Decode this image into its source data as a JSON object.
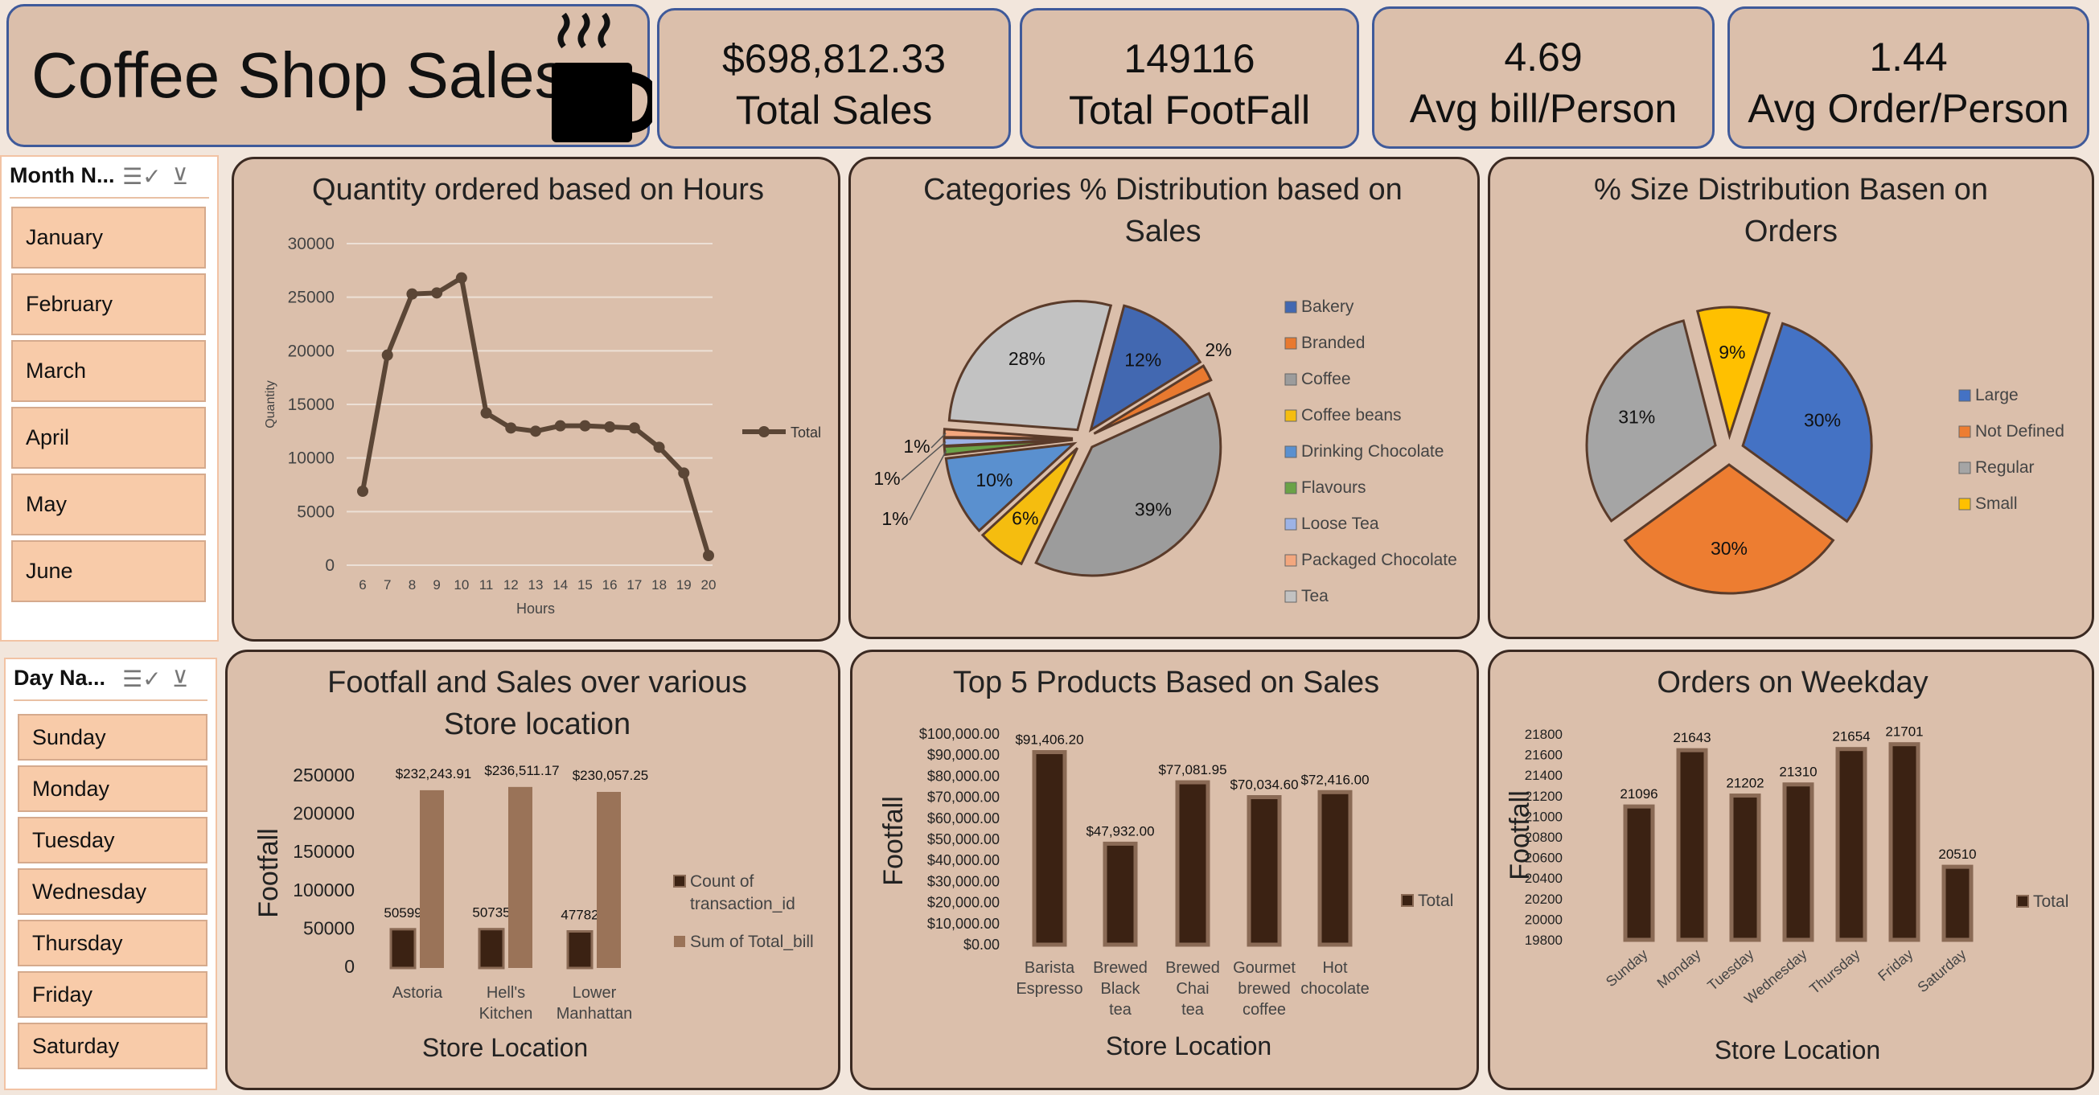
{
  "header": {
    "title": "Coffee Shop Sales"
  },
  "kpis": [
    {
      "value": "$698,812.33",
      "label": "Total Sales"
    },
    {
      "value": "149116",
      "label": "Total FootFall"
    },
    {
      "value": "4.69",
      "label": "Avg bill/Person"
    },
    {
      "value": "1.44",
      "label": "Avg Order/Person"
    }
  ],
  "month_slicer": {
    "header": "Month N...",
    "items": [
      "January",
      "February",
      "March",
      "April",
      "May",
      "June"
    ]
  },
  "day_slicer": {
    "header": "Day Na...",
    "items": [
      "Sunday",
      "Monday",
      "Tuesday",
      "Wednesday",
      "Thursday",
      "Friday",
      "Saturday"
    ]
  },
  "colors": {
    "panel": "#dbbfab",
    "border": "#3b2a22",
    "dark_bar": "#3b2213",
    "light_bar": "#9a7358",
    "line": "#5b4636"
  },
  "chart_data": [
    {
      "type": "line",
      "title": "Quantity ordered based on Hours",
      "xlabel": "Hours",
      "ylabel": "Quantity",
      "x": [
        6,
        7,
        8,
        9,
        10,
        11,
        12,
        13,
        14,
        15,
        16,
        17,
        18,
        19,
        20
      ],
      "series": [
        {
          "name": "Total",
          "values": [
            6900,
            19600,
            25300,
            25400,
            26800,
            14200,
            12800,
            12500,
            13000,
            13000,
            12900,
            12800,
            11000,
            8600,
            900
          ]
        }
      ],
      "ylim": [
        0,
        30000
      ],
      "yticks": [
        0,
        5000,
        10000,
        15000,
        20000,
        25000,
        30000
      ],
      "grid": true,
      "legend": "right"
    },
    {
      "type": "pie",
      "title": "Categories % Distribution based on Sales",
      "legend": "right",
      "slices": [
        {
          "label": "Bakery",
          "value": 12,
          "text": "12%",
          "color": "#4268b1"
        },
        {
          "label": "Branded",
          "value": 2,
          "text": "2%",
          "color": "#e8792f"
        },
        {
          "label": "Coffee",
          "value": 39,
          "text": "39%",
          "color": "#9c9c9c"
        },
        {
          "label": "Coffee beans",
          "value": 6,
          "text": "6%",
          "color": "#f5bd0f"
        },
        {
          "label": "Drinking Chocolate",
          "value": 10,
          "text": "10%",
          "color": "#5a90cf"
        },
        {
          "label": "Flavours",
          "value": 1,
          "text": "1%",
          "color": "#6aa247"
        },
        {
          "label": "Loose Tea",
          "value": 1,
          "text": "1%",
          "color": "#9db3e6"
        },
        {
          "label": "Packaged Chocolate",
          "value": 1,
          "text": "1%",
          "color": "#f3a77e"
        },
        {
          "label": "Tea",
          "value": 28,
          "text": "28%",
          "color": "#c2c2c2"
        }
      ]
    },
    {
      "type": "pie",
      "title": "% Size Distribution Basen on Orders",
      "legend": "right",
      "slices": [
        {
          "label": "Large",
          "value": 30,
          "text": "30%",
          "color": "#4472c4"
        },
        {
          "label": "Not Defined",
          "value": 30,
          "text": "30%",
          "color": "#ed7d31"
        },
        {
          "label": "Regular",
          "value": 31,
          "text": "31%",
          "color": "#a5a5a5"
        },
        {
          "label": "Small",
          "value": 9,
          "text": "9%",
          "color": "#ffc000"
        }
      ]
    },
    {
      "type": "bar",
      "title": "Footfall and Sales over various Store location",
      "xlabel": "Store Location",
      "ylabel": "Footfall",
      "categories": [
        "Astoria",
        "Hell's Kitchen",
        "Lower Manhattan"
      ],
      "series": [
        {
          "name": "Count of transaction_id",
          "values": [
            50599,
            50735,
            47782
          ],
          "labels": [
            "50599",
            "50735",
            "47782"
          ]
        },
        {
          "name": "Sum of Total_bill",
          "values": [
            232243.91,
            236511.17,
            230057.25
          ],
          "labels": [
            "$232,243.91",
            "$236,511.17",
            "$230,057.25"
          ]
        }
      ],
      "ylim": [
        0,
        250000
      ],
      "yticks": [
        "0",
        "50000",
        "100000",
        "150000",
        "200000",
        "250000"
      ],
      "legend": "right"
    },
    {
      "type": "bar",
      "title": "Top 5 Products Based on Sales",
      "xlabel": "Store Location",
      "ylabel": "Footfall",
      "categories": [
        "Barista Espresso",
        "Brewed Black tea",
        "Brewed Chai tea",
        "Gourmet brewed coffee",
        "Hot chocolate"
      ],
      "series": [
        {
          "name": "Total",
          "values": [
            91406.2,
            47932.0,
            77081.95,
            70034.6,
            72416.0
          ],
          "labels": [
            "$91,406.20",
            "$47,932.00",
            "$77,081.95",
            "$70,034.60",
            "$72,416.00"
          ]
        }
      ],
      "ylim": [
        0,
        100000
      ],
      "yticks": [
        "$0.00",
        "$10,000.00",
        "$20,000.00",
        "$30,000.00",
        "$40,000.00",
        "$50,000.00",
        "$60,000.00",
        "$70,000.00",
        "$80,000.00",
        "$90,000.00",
        "$100,000.00"
      ],
      "legend": "right"
    },
    {
      "type": "bar",
      "title": "Orders on Weekday",
      "xlabel": "Store Location",
      "ylabel": "Footfall",
      "categories": [
        "Sunday",
        "Monday",
        "Tuesday",
        "Wednesday",
        "Thursday",
        "Friday",
        "Saturday"
      ],
      "series": [
        {
          "name": "Total",
          "values": [
            21096,
            21643,
            21202,
            21310,
            21654,
            21701,
            20510
          ],
          "labels": [
            "21096",
            "21643",
            "21202",
            "21310",
            "21654",
            "21701",
            "20510"
          ]
        }
      ],
      "ylim": [
        19800,
        21800
      ],
      "yticks": [
        "19800",
        "20000",
        "20200",
        "20400",
        "20600",
        "20800",
        "21000",
        "21200",
        "21400",
        "21600",
        "21800"
      ],
      "legend": "right"
    }
  ]
}
